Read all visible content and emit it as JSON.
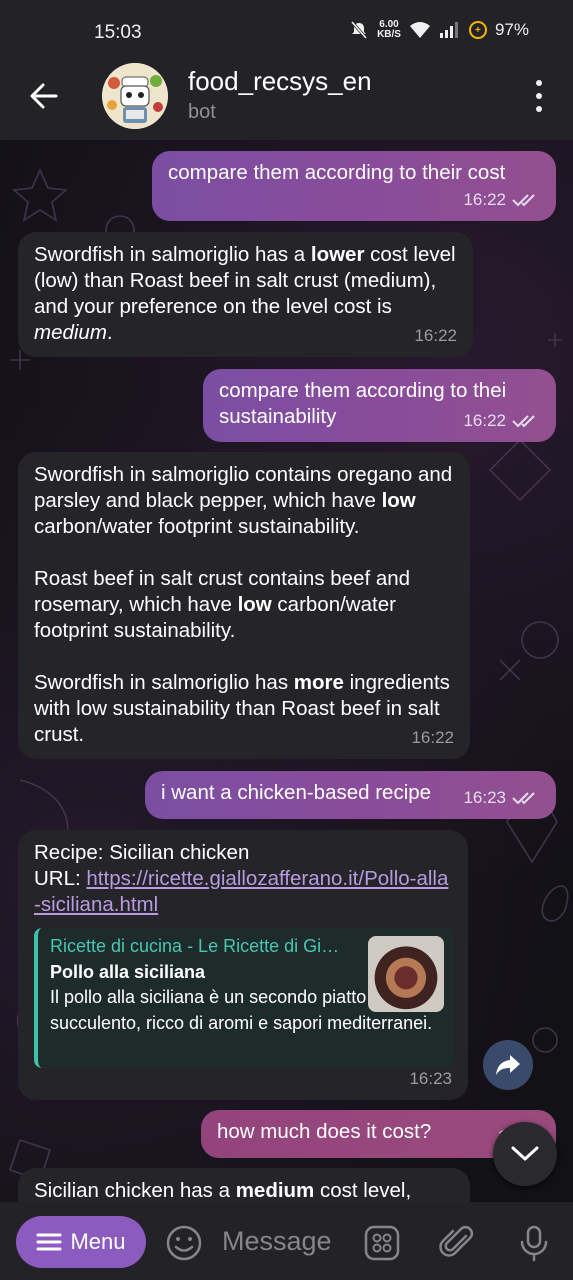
{
  "status_bar": {
    "time": "15:03",
    "net_speed_value": "6.00",
    "net_speed_unit": "KB/S",
    "battery": "97%"
  },
  "header": {
    "title": "food_recsys_en",
    "subtitle": "bot"
  },
  "messages": [
    {
      "dir": "out",
      "text": "compare them according to their cost",
      "time": "16:22"
    },
    {
      "dir": "in",
      "time": "16:22",
      "parts": [
        "Swordfish in salmoriglio has a ",
        "lower",
        " cost level (low) than Roast beef in salt crust (medium), and your preference on the level cost is ",
        "medium",
        "."
      ]
    },
    {
      "dir": "out",
      "text": "compare them according to thei sustainability",
      "time": "16:22"
    },
    {
      "dir": "in",
      "time": "16:22",
      "paragraphs": [
        [
          "Swordfish in salmoriglio contains oregano and parsley and black pepper, which have ",
          "low",
          " carbon/water footprint sustainability."
        ],
        [
          "Roast beef in salt crust contains beef and rosemary, which have ",
          "low",
          " carbon/water footprint sustainability."
        ],
        [
          "Swordfish in salmoriglio has ",
          "more",
          " ingredients with low sustainability than Roast beef in salt crust."
        ]
      ]
    },
    {
      "dir": "out",
      "text": "i want a chicken-based recipe",
      "time": "16:23"
    },
    {
      "dir": "in",
      "time": "16:23",
      "recipe_line": "Recipe: Sicilian chicken",
      "url_label": "URL: ",
      "url": "https://ricette.giallozafferano.it/Pollo-alla-siciliana.html",
      "preview": {
        "site": "Ricette di cucina - Le Ricette di GialloZafferano",
        "title": "Pollo alla siciliana",
        "description": "Il pollo alla siciliana è un secondo piatto succulento, ricco di aromi e sapori mediterranei."
      }
    },
    {
      "dir": "out",
      "text": "how much does it cost?",
      "time": "16:23"
    },
    {
      "dir": "in",
      "parts": [
        "Sicilian chicken has a ",
        "medium",
        " cost level,"
      ]
    }
  ],
  "composer": {
    "menu_label": "Menu",
    "placeholder": "Message"
  },
  "icons": [
    "back-arrow-icon",
    "more-vert-icon",
    "emoji-icon",
    "bot-keyboard-icon",
    "attach-icon",
    "mic-icon",
    "share-icon",
    "chevron-down-icon"
  ],
  "colors": {
    "outgoing_bubble": "#8a4c9a",
    "incoming_bubble": "#252428",
    "menu_button": "#8b5bbf",
    "link": "#b79be0",
    "preview_accent": "#3ec1ad"
  }
}
